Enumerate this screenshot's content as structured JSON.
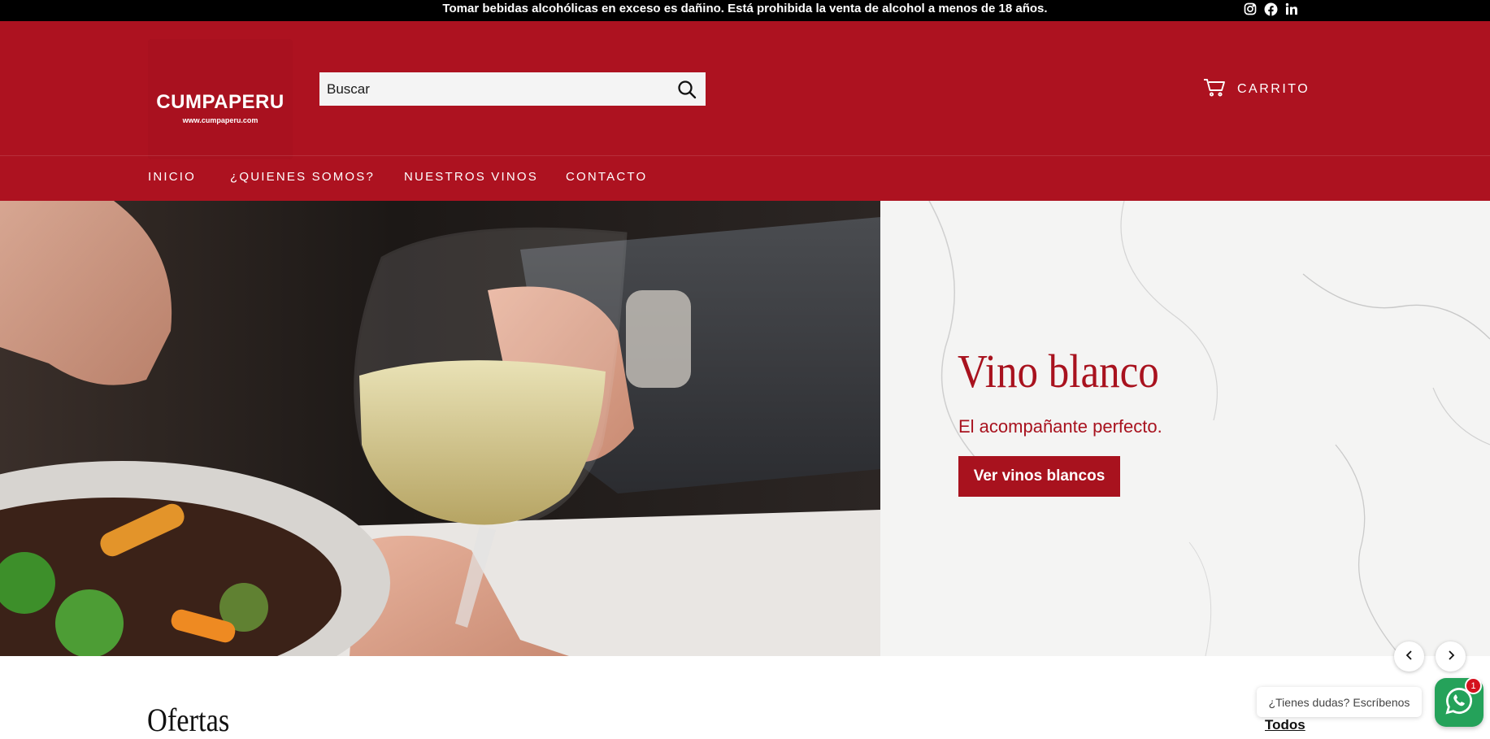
{
  "announcement": {
    "text": "Tomar bebidas alcohólicas en exceso es dañino. Está prohibida la venta de alcohol a menos de 18 años.",
    "social_icons": [
      "instagram-icon",
      "facebook-icon",
      "linkedin-icon"
    ]
  },
  "header": {
    "logo": {
      "name": "CUMPAPERU",
      "url_text": "www.cumpaperu.com"
    },
    "search": {
      "placeholder": "Buscar"
    },
    "cart_label": "CARRITO"
  },
  "nav": {
    "items": [
      {
        "label": "INICIO"
      },
      {
        "label": "¿QUIENES SOMOS?"
      },
      {
        "label": "NUESTROS VINOS"
      },
      {
        "label": "CONTACTO"
      }
    ]
  },
  "hero": {
    "title": "Vino blanco",
    "subtitle": "El acompañante perfecto.",
    "button_label": "Ver vinos blancos"
  },
  "offers": {
    "title": "Ofertas",
    "link_label": "Todos"
  },
  "whatsapp": {
    "bubble_text": "¿Tienes dudas? Escríbenos",
    "badge_count": "1"
  },
  "colors": {
    "brand_red": "#ad1220",
    "accent_red": "#a8121e",
    "announcement_bg": "#000000",
    "whatsapp_green": "#25a25a",
    "badge_red": "#d4111e"
  }
}
